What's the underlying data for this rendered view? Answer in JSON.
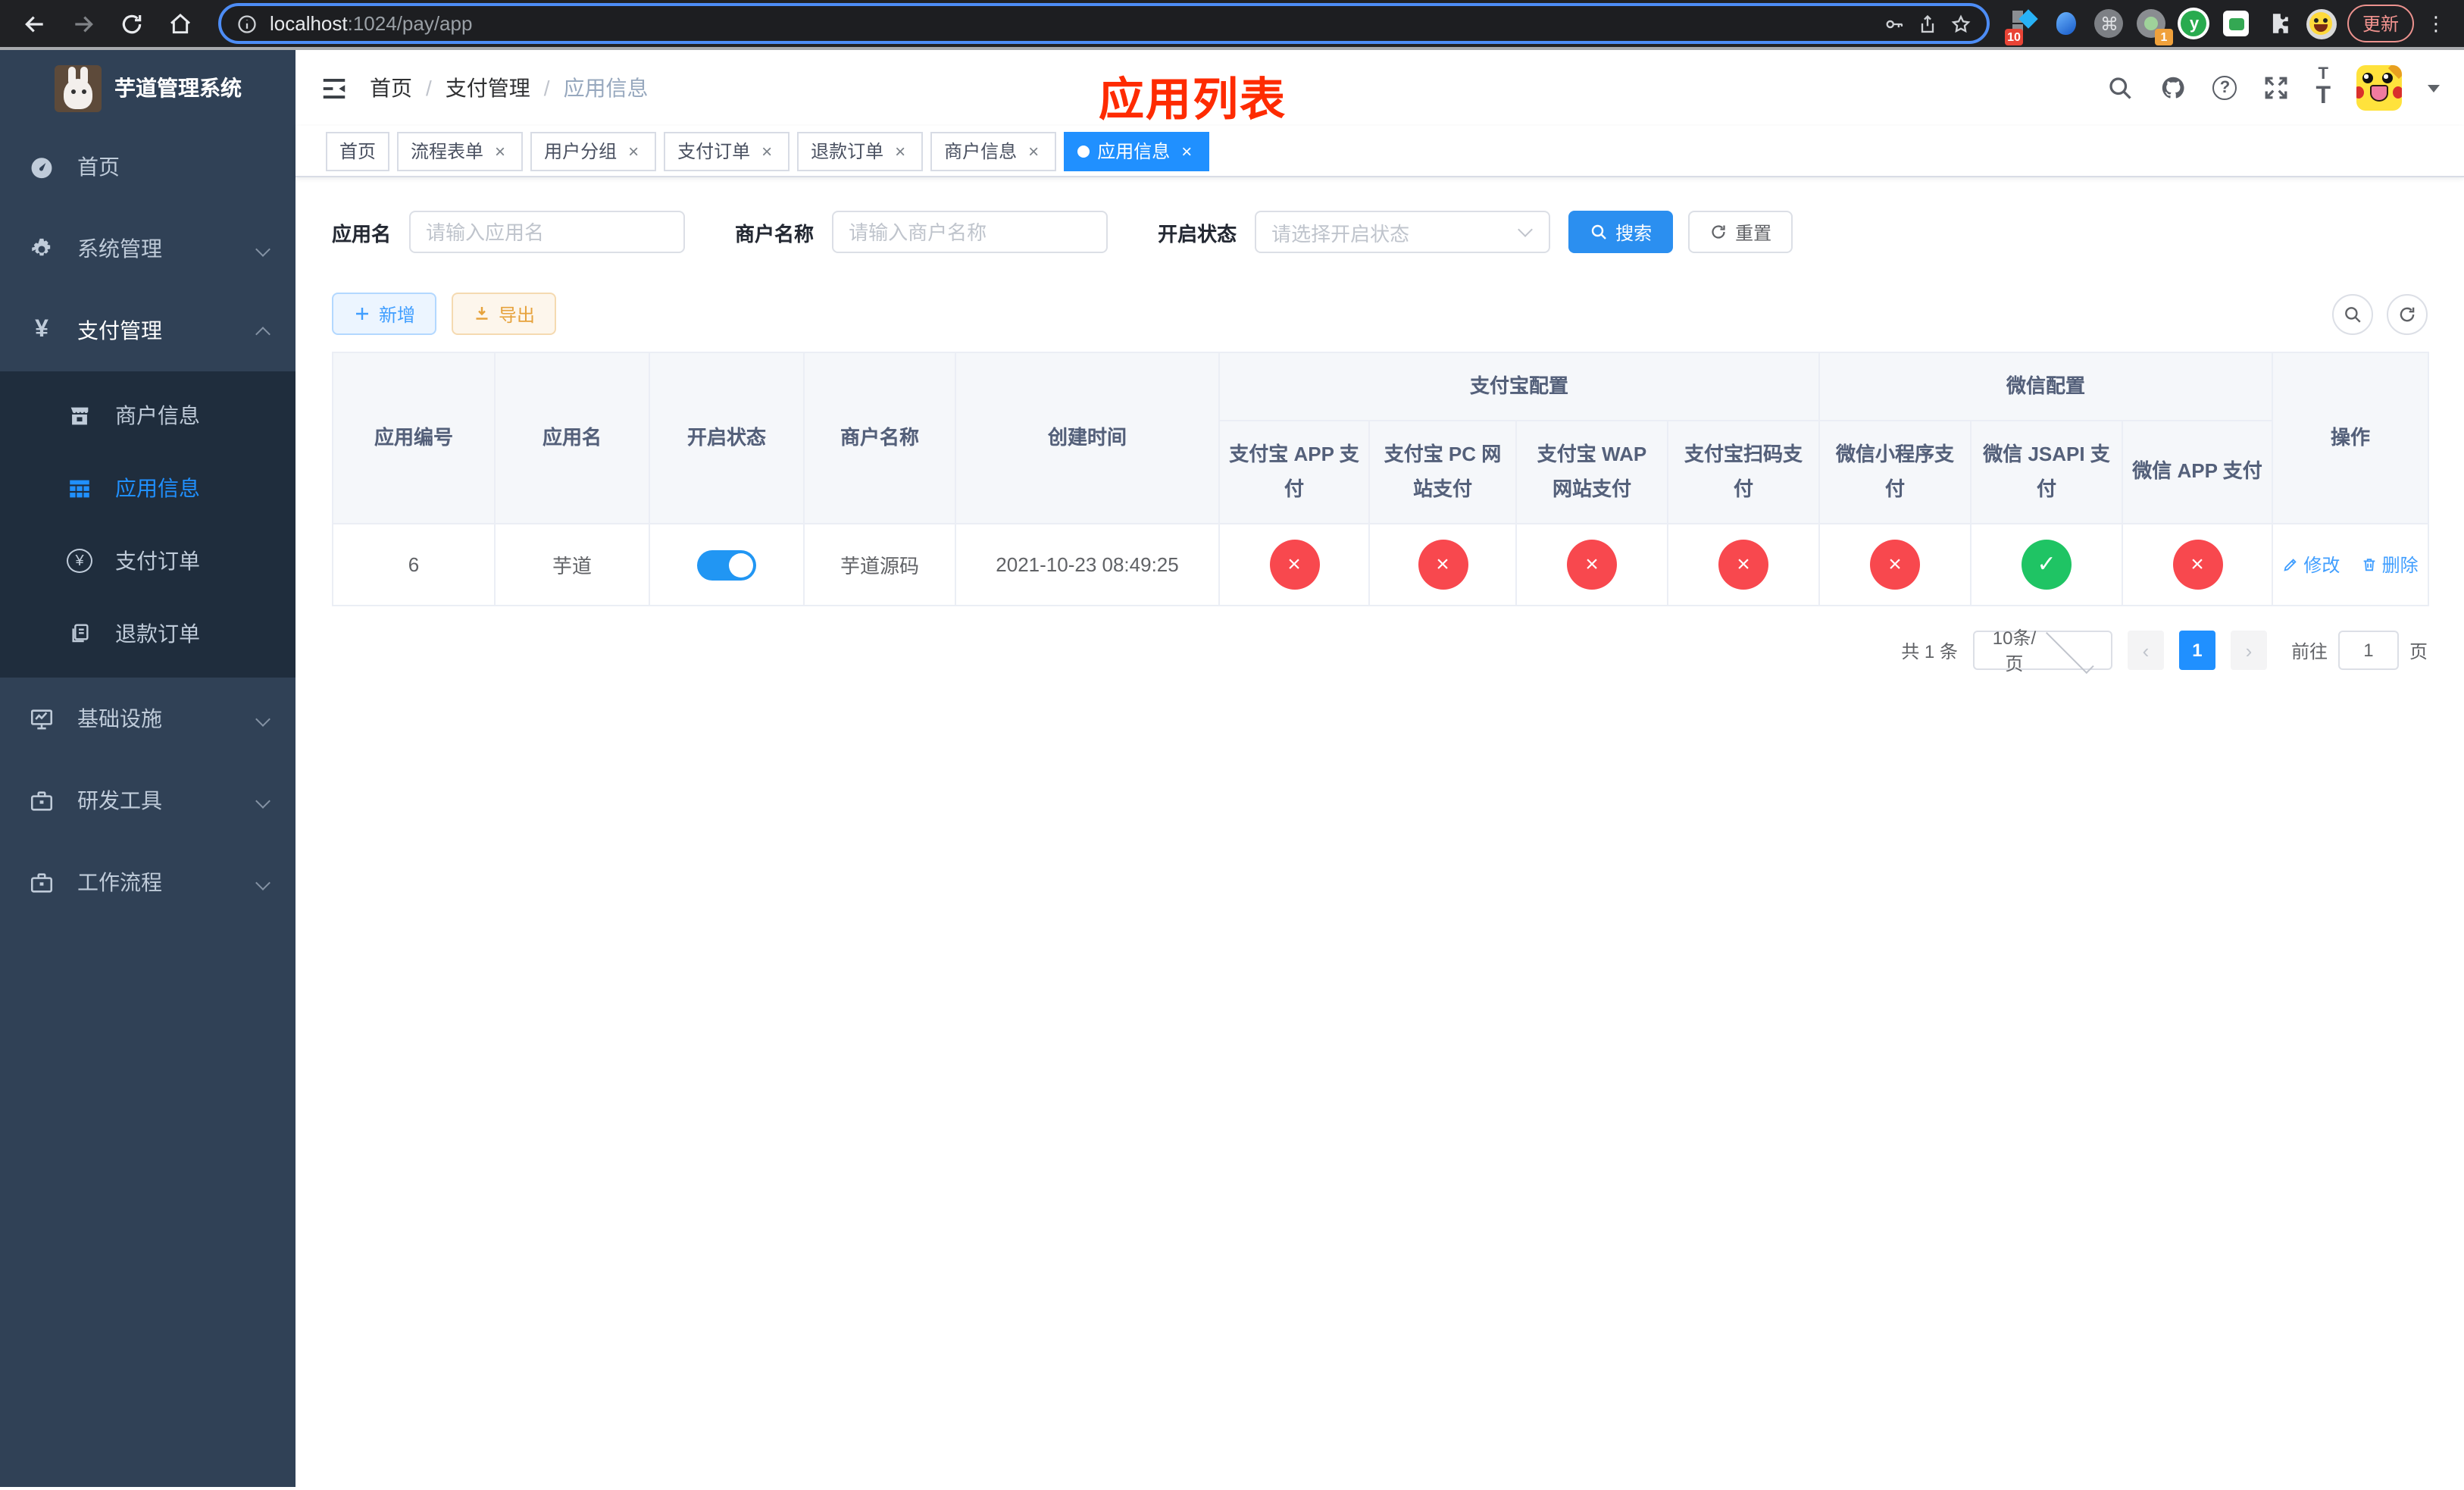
{
  "browser": {
    "url_host": "localhost",
    "url_rest": ":1024/pay/app",
    "update_label": "更新",
    "ext_badge_10": "10",
    "ext_badge_1": "1",
    "ext_y_letter": "y",
    "cmd_glyph": "⌘"
  },
  "sidebar": {
    "title": "芋道管理系统",
    "items": [
      {
        "label": "首页"
      },
      {
        "label": "系统管理"
      },
      {
        "label": "支付管理"
      },
      {
        "label": "基础设施"
      },
      {
        "label": "研发工具"
      },
      {
        "label": "工作流程"
      }
    ],
    "payment_submenu": [
      {
        "label": "商户信息"
      },
      {
        "label": "应用信息",
        "active": true
      },
      {
        "label": "支付订单"
      },
      {
        "label": "退款订单"
      }
    ]
  },
  "header": {
    "breadcrumbs": [
      "首页",
      "支付管理",
      "应用信息"
    ]
  },
  "annotation": {
    "title": "应用列表"
  },
  "tabs": {
    "items": [
      {
        "label": "首页",
        "closable": false
      },
      {
        "label": "流程表单",
        "closable": true
      },
      {
        "label": "用户分组",
        "closable": true
      },
      {
        "label": "支付订单",
        "closable": true
      },
      {
        "label": "退款订单",
        "closable": true
      },
      {
        "label": "商户信息",
        "closable": true
      },
      {
        "label": "应用信息",
        "closable": true,
        "active": true
      }
    ]
  },
  "filters": {
    "app_name_label": "应用名",
    "app_name_placeholder": "请输入应用名",
    "merchant_label": "商户名称",
    "merchant_placeholder": "请输入商户名称",
    "status_label": "开启状态",
    "status_placeholder": "请选择开启状态",
    "search_label": "搜索",
    "reset_label": "重置"
  },
  "toolbar": {
    "add_label": "新增",
    "export_label": "导出"
  },
  "table": {
    "columns": [
      "应用编号",
      "应用名",
      "开启状态",
      "商户名称",
      "创建时间",
      "操作"
    ],
    "groups": [
      {
        "label": "支付宝配置",
        "children": [
          "支付宝 APP 支付",
          "支付宝 PC 网站支付",
          "支付宝 WAP 网站支付",
          "支付宝扫码支付"
        ]
      },
      {
        "label": "微信配置",
        "children": [
          "微信小程序支付",
          "微信 JSAPI 支付",
          "微信 APP 支付"
        ]
      }
    ],
    "row": {
      "id": "6",
      "name": "芋道",
      "enabled": true,
      "merchant": "芋道源码",
      "created_at": "2021-10-23 08:49:25",
      "channel_status": [
        "fail",
        "fail",
        "fail",
        "fail",
        "fail",
        "success",
        "fail"
      ],
      "edit_label": "修改",
      "delete_label": "删除"
    }
  },
  "pagination": {
    "total_text": "共 1 条",
    "page_size": "10条/页",
    "current_page": "1",
    "jump_prefix": "前往",
    "jump_value": "1",
    "jump_suffix": "页"
  },
  "icons": {
    "close_glyph": "×",
    "fail_glyph": "×",
    "success_glyph": "✓",
    "yen_glyph": "¥",
    "question_glyph": "?",
    "prev_glyph": "‹",
    "next_glyph": "›"
  },
  "colors": {
    "accent_blue": "#2090ff",
    "link_blue": "#409eff",
    "danger_red": "#f8484e",
    "success_green": "#1fc464",
    "annotation_red": "#fe2b01",
    "warning_yellow": "#e6a23c",
    "sidebar_bg": "#304156",
    "submenu_bg": "#1f2d3d"
  }
}
